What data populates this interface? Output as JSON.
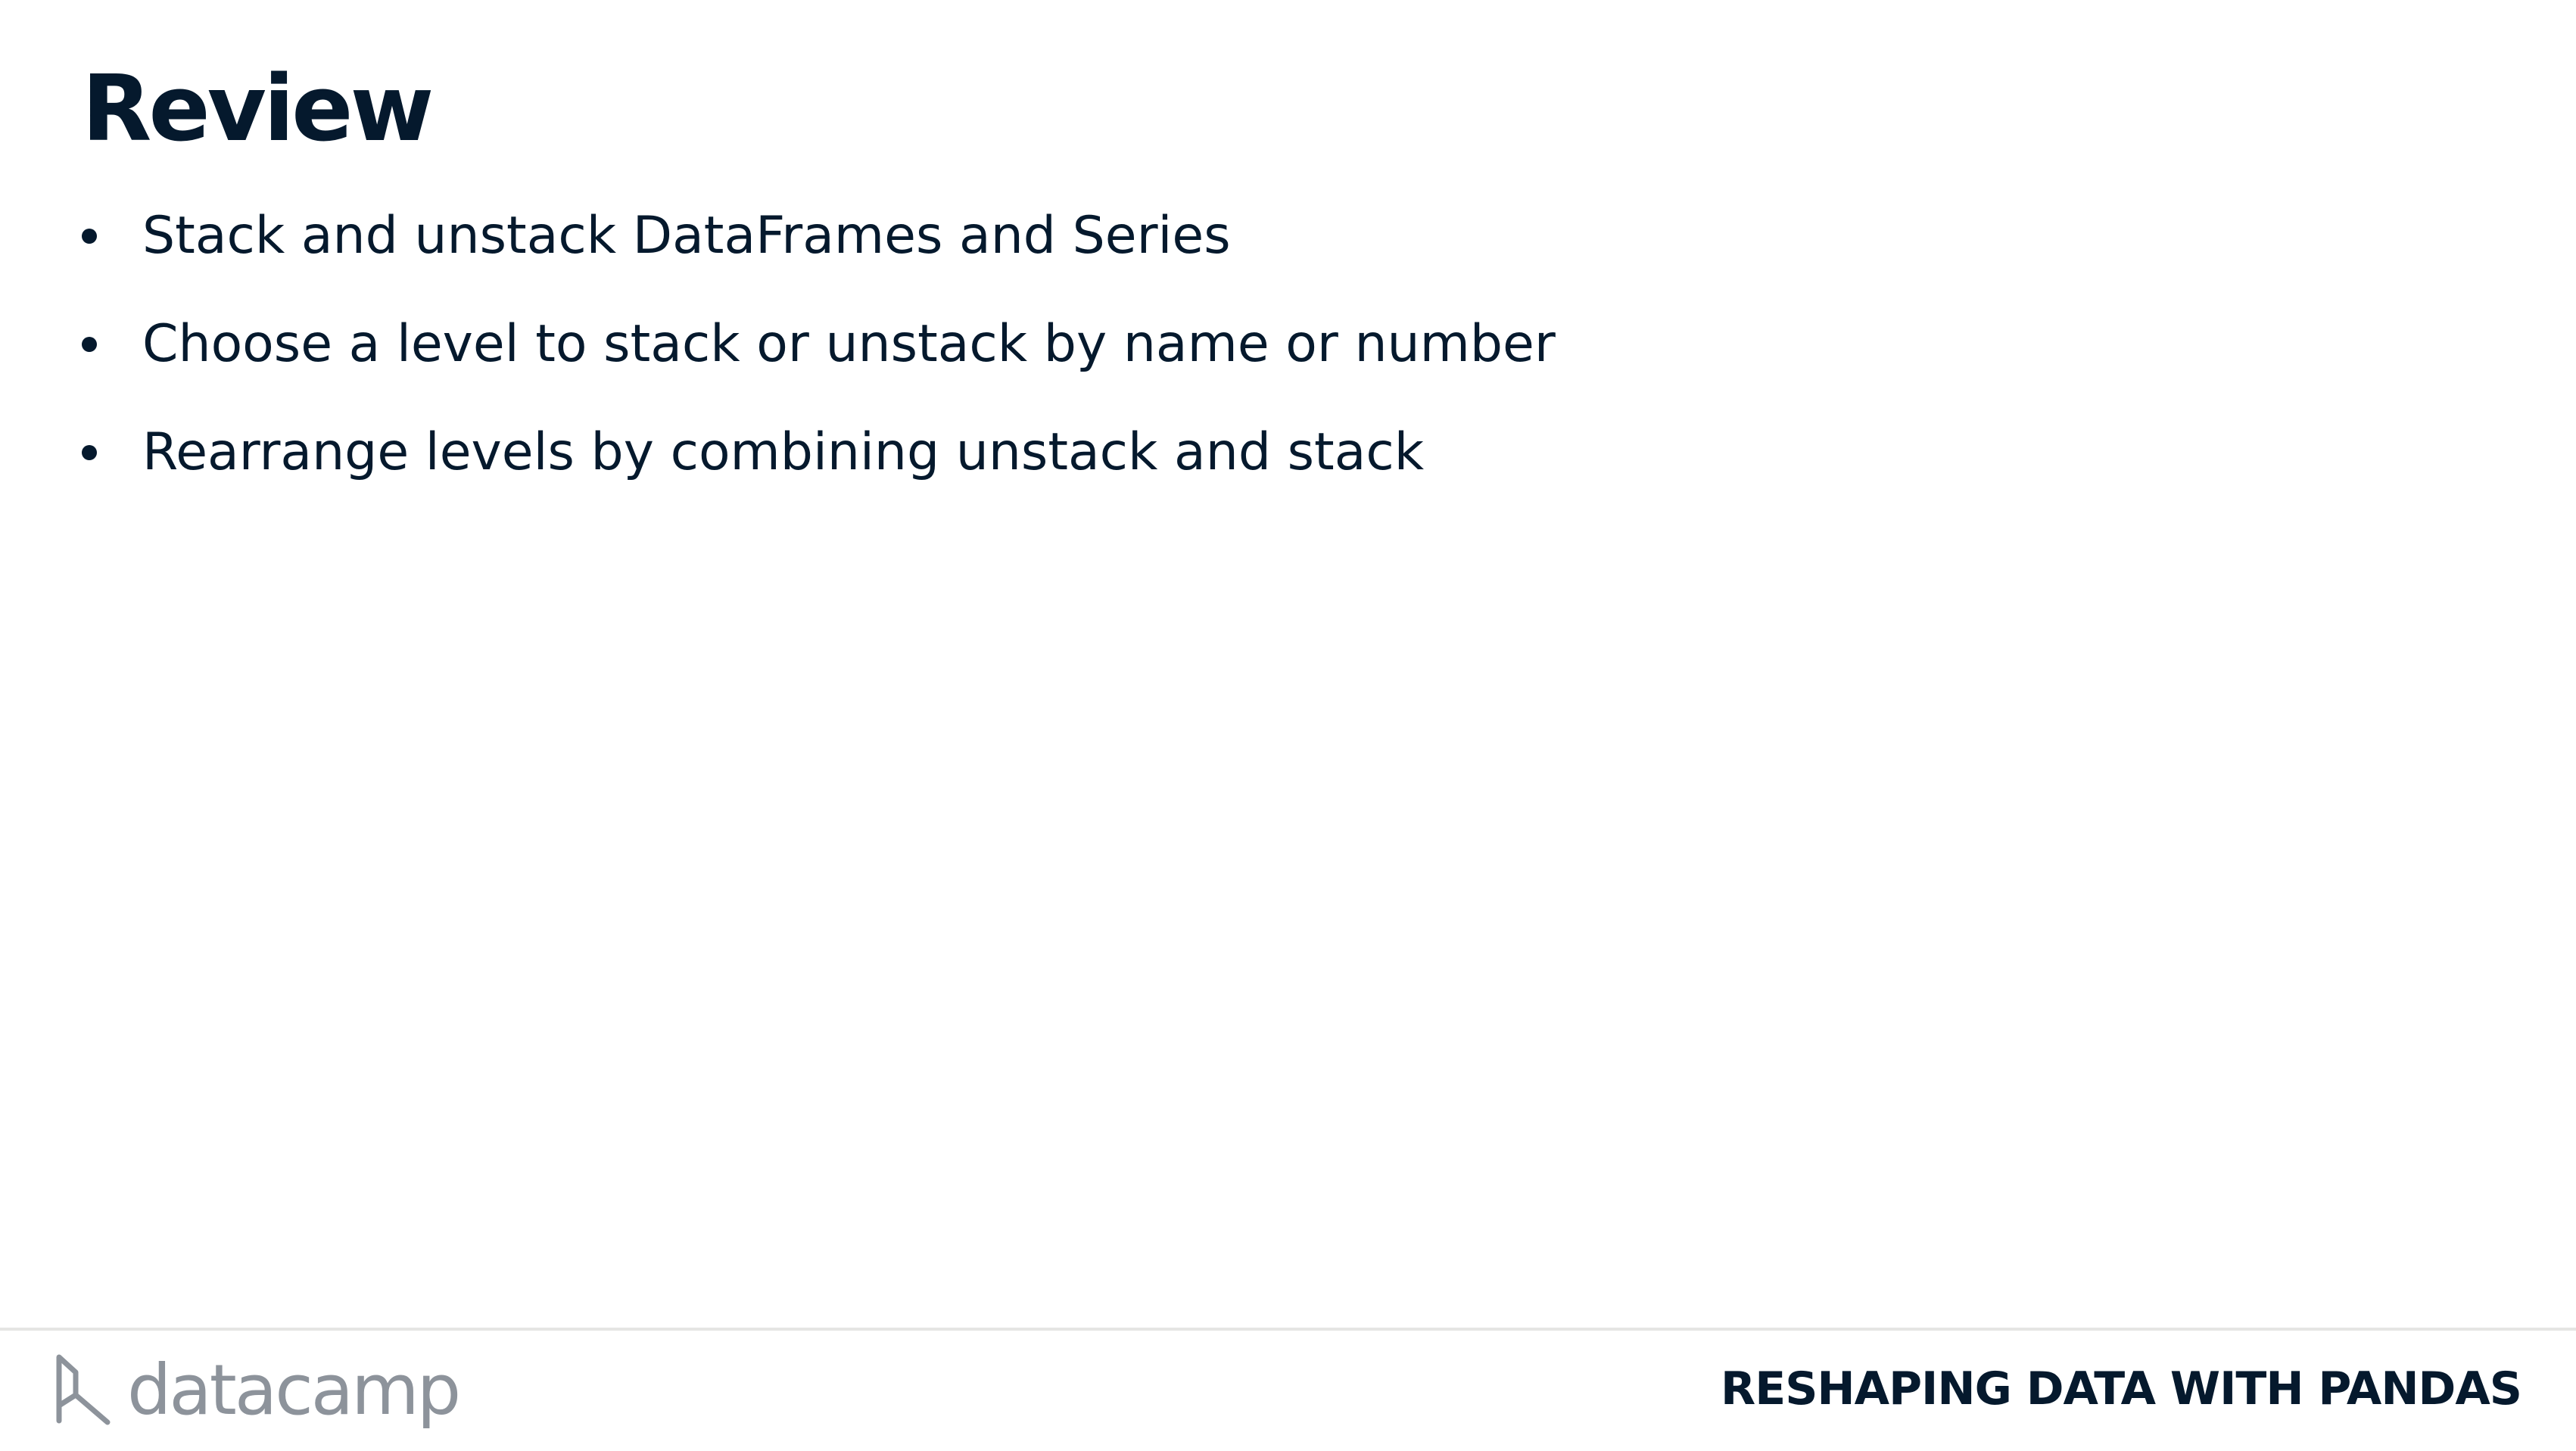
{
  "slide": {
    "title": "Review",
    "bullets": [
      "Stack and unstack DataFrames and Series",
      "Choose a level to stack or unstack by name or number",
      "Rearrange levels by combining unstack and stack"
    ]
  },
  "footer": {
    "logo_text": "datacamp",
    "course_title": "RESHAPING DATA WITH PANDAS",
    "logo_icon": "datacamp-logo-icon"
  },
  "colors": {
    "text": "#05192d",
    "logo": "#8d939b",
    "divider": "#e5e5e3",
    "background": "#ffffff"
  }
}
